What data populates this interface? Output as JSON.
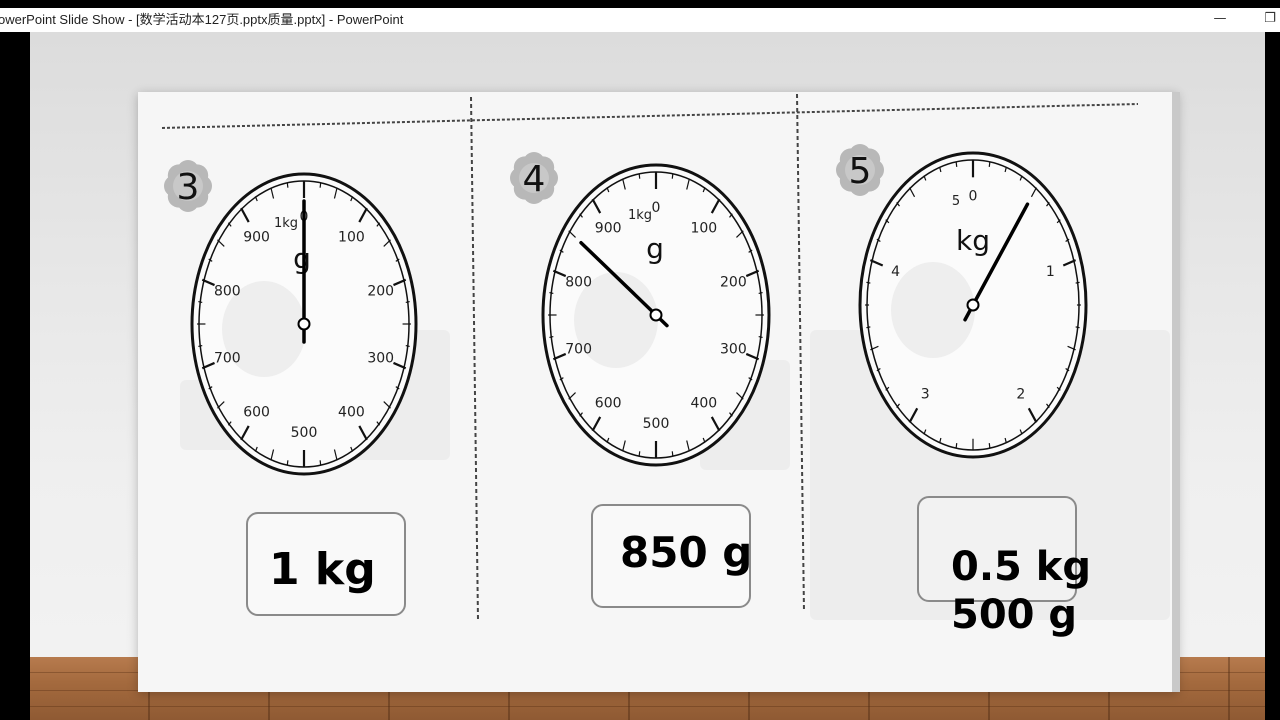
{
  "window": {
    "title": "owerPoint Slide Show - [数学活动本127页.pptx质量.pptx] - PowerPoint",
    "minimize_icon": "minimize-icon",
    "restore_icon": "restore-icon"
  },
  "dials": [
    {
      "number": "3",
      "unit": "g",
      "top_label": "1kg",
      "labels": [
        "0",
        "100",
        "200",
        "300",
        "400",
        "500",
        "600",
        "700",
        "800",
        "900"
      ],
      "needle_reading": 1000,
      "answer_lines": [
        "1 kg"
      ]
    },
    {
      "number": "4",
      "unit": "g",
      "top_label": "1kg",
      "labels": [
        "0",
        "100",
        "200",
        "300",
        "400",
        "500",
        "600",
        "700",
        "800",
        "900"
      ],
      "needle_reading": 850,
      "answer_lines": [
        "850 g"
      ]
    },
    {
      "number": "5",
      "unit": "kg",
      "top_label": "5",
      "labels": [
        "0",
        "1",
        "2",
        "3",
        "4"
      ],
      "needle_reading": 0.5,
      "answer_lines": [
        "0.5 kg",
        "500 g"
      ]
    }
  ]
}
